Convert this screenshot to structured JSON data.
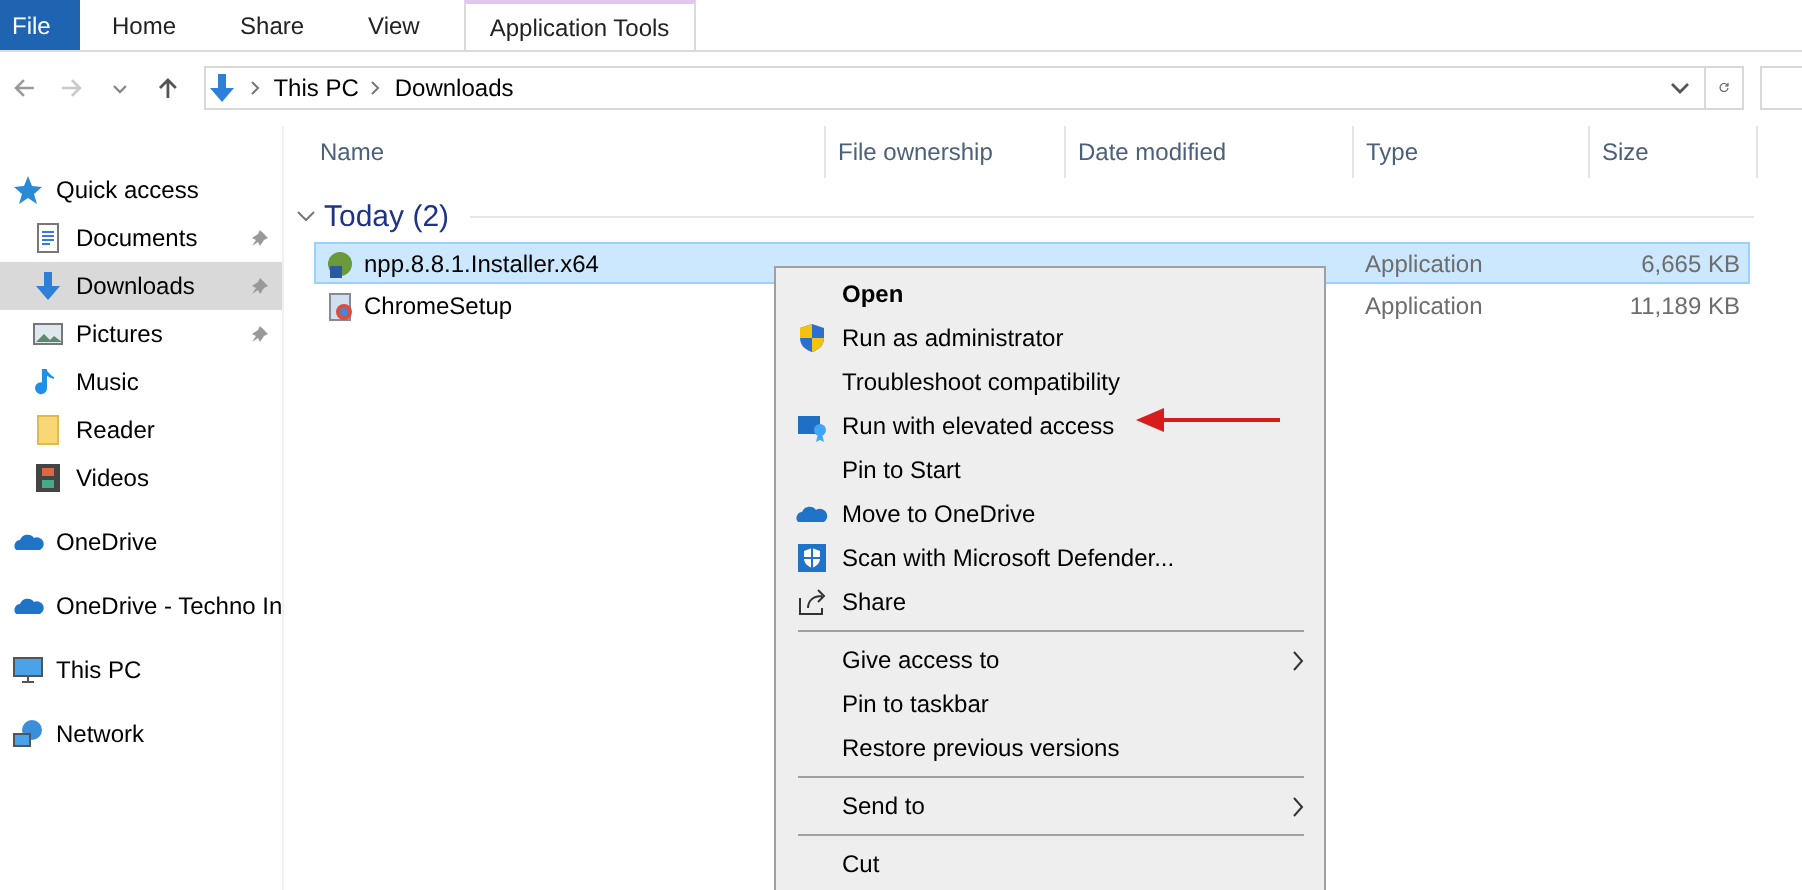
{
  "ribbon": {
    "tabs": [
      {
        "label": "File",
        "kind": "file",
        "selected": false
      },
      {
        "label": "Home",
        "kind": "tab",
        "selected": false
      },
      {
        "label": "Share",
        "kind": "tab",
        "selected": false
      },
      {
        "label": "View",
        "kind": "tab",
        "selected": false
      },
      {
        "label": "Application Tools",
        "kind": "contextual",
        "selected": false
      }
    ]
  },
  "address_bar": {
    "path": [
      "This PC",
      "Downloads"
    ]
  },
  "sidebar": {
    "items": [
      {
        "label": "Quick access",
        "selected": false,
        "children": [
          {
            "label": "Documents",
            "pinned": true,
            "selected": false
          },
          {
            "label": "Downloads",
            "pinned": true,
            "selected": true
          },
          {
            "label": "Pictures",
            "pinned": true,
            "selected": false
          },
          {
            "label": "Music",
            "pinned": false,
            "selected": false
          },
          {
            "label": "Reader",
            "pinned": false,
            "selected": false
          },
          {
            "label": "Videos",
            "pinned": false,
            "selected": false
          }
        ]
      },
      {
        "label": "OneDrive",
        "selected": false
      },
      {
        "label": "OneDrive - Techno In",
        "selected": false
      },
      {
        "label": "This PC",
        "selected": false
      },
      {
        "label": "Network",
        "selected": false
      }
    ]
  },
  "table": {
    "columns": [
      "Name",
      "File ownership",
      "Date modified",
      "Type",
      "Size"
    ],
    "groups": [
      {
        "label": "Today (2)",
        "expanded": true,
        "rows": [
          {
            "name": "npp.8.8.1.Installer.x64",
            "type": "Application",
            "size": "6,665 KB",
            "selected": true
          },
          {
            "name": "ChromeSetup",
            "type": "Application",
            "size": "11,189 KB",
            "selected": false
          }
        ]
      }
    ]
  },
  "context_menu": {
    "items": [
      {
        "kind": "item",
        "label": "Open",
        "default": true
      },
      {
        "kind": "item",
        "label": "Run as administrator"
      },
      {
        "kind": "item",
        "label": "Troubleshoot compatibility"
      },
      {
        "kind": "item",
        "label": "Run with elevated access",
        "annotated": true
      },
      {
        "kind": "item",
        "label": "Pin to Start"
      },
      {
        "kind": "item",
        "label": "Move to OneDrive"
      },
      {
        "kind": "item",
        "label": "Scan with Microsoft Defender..."
      },
      {
        "kind": "item",
        "label": "Share"
      },
      {
        "kind": "separator"
      },
      {
        "kind": "item",
        "label": "Give access to",
        "submenu": true
      },
      {
        "kind": "item",
        "label": "Pin to taskbar"
      },
      {
        "kind": "item",
        "label": "Restore previous versions"
      },
      {
        "kind": "separator"
      },
      {
        "kind": "item",
        "label": "Send to",
        "submenu": true
      },
      {
        "kind": "separator"
      },
      {
        "kind": "item",
        "label": "Cut"
      }
    ]
  }
}
